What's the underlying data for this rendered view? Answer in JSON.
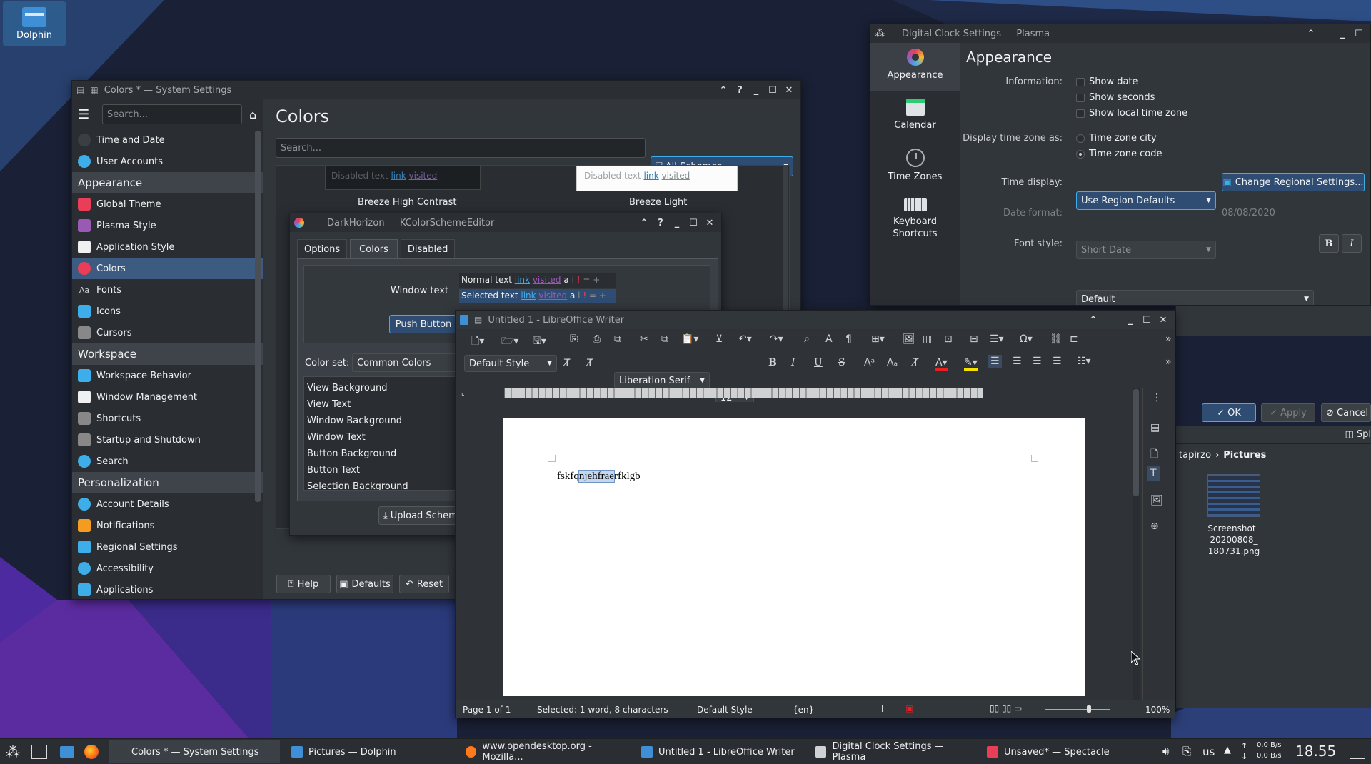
{
  "colors": {
    "accent": "#3daee9",
    "selection": "#3d5a80",
    "window": "#31363b"
  },
  "desktop": {
    "dolphin_label": "Dolphin"
  },
  "system_settings": {
    "title": "Colors * — System Settings",
    "search_placeholder": "Search...",
    "sidebar": {
      "items_top": [
        {
          "label": "Time and Date",
          "icon": "clock-icon"
        },
        {
          "label": "User Accounts",
          "icon": "user-icon"
        }
      ],
      "appearance_header": "Appearance",
      "appearance_items": [
        {
          "label": "Global Theme",
          "icon": "global-theme-icon"
        },
        {
          "label": "Plasma Style",
          "icon": "plasma-style-icon"
        },
        {
          "label": "Application Style",
          "icon": "application-style-icon"
        },
        {
          "label": "Colors",
          "icon": "colors-icon"
        },
        {
          "label": "Fonts",
          "icon": "fonts-icon"
        },
        {
          "label": "Icons",
          "icon": "icons-icon"
        },
        {
          "label": "Cursors",
          "icon": "cursors-icon"
        }
      ],
      "workspace_header": "Workspace",
      "workspace_items": [
        {
          "label": "Workspace Behavior",
          "icon": "workspace-behavior-icon"
        },
        {
          "label": "Window Management",
          "icon": "window-management-icon"
        },
        {
          "label": "Shortcuts",
          "icon": "shortcuts-icon"
        },
        {
          "label": "Startup and Shutdown",
          "icon": "startup-icon"
        },
        {
          "label": "Search",
          "icon": "search-icon"
        }
      ],
      "personalization_header": "Personalization",
      "personalization_items": [
        {
          "label": "Account Details",
          "icon": "account-icon"
        },
        {
          "label": "Notifications",
          "icon": "bell-icon"
        },
        {
          "label": "Regional Settings",
          "icon": "regional-icon"
        },
        {
          "label": "Accessibility",
          "icon": "accessibility-icon"
        },
        {
          "label": "Applications",
          "icon": "applications-icon"
        }
      ]
    },
    "page_title": "Colors",
    "page_search_placeholder": "Search...",
    "scheme_filter": "All Schemes",
    "scheme_preview_left": {
      "disabled": "Disabled text",
      "link": "link",
      "visited": "visited",
      "name": "Breeze High Contrast"
    },
    "scheme_preview_right": {
      "disabled": "Disabled text",
      "link": "link",
      "visited": "visited",
      "name": "Breeze Light"
    },
    "footer": {
      "help": "Help",
      "defaults": "Defaults",
      "reset": "Reset"
    }
  },
  "kcolor": {
    "title": "DarkHorizon — KColorSchemeEditor",
    "tabs": [
      "Options",
      "Colors",
      "Disabled"
    ],
    "window_text_label": "Window text",
    "normal_text": "Normal text",
    "selected_text": "Selected text",
    "link": "link",
    "visited": "visited",
    "sample_chars": [
      "a",
      "i",
      "!",
      "=",
      "+"
    ],
    "push_button": "Push Button",
    "color_set_label": "Color set:",
    "color_set_value": "Common Colors",
    "color_roles": [
      "View Background",
      "View Text",
      "Window Background",
      "Window Text",
      "Button Background",
      "Button Text",
      "Selection Background",
      "Selection Text"
    ],
    "upload": "Upload Schem"
  },
  "clock": {
    "title": "Digital Clock Settings — Plasma",
    "nav": [
      {
        "label": "Appearance",
        "icon": "appearance-icon"
      },
      {
        "label": "Calendar",
        "icon": "calendar-icon"
      },
      {
        "label": "Time Zones",
        "icon": "clock-icon"
      },
      {
        "label": "Keyboard Shortcuts",
        "icon": "keyboard-icon"
      }
    ],
    "heading": "Appearance",
    "information_label": "Information:",
    "checks": [
      "Show date",
      "Show seconds",
      "Show local time zone"
    ],
    "timezone_label": "Display time zone as:",
    "radios": [
      "Time zone city",
      "Time zone code"
    ],
    "time_display_label": "Time display:",
    "time_display_value": "Use Region Defaults",
    "change_regional": "Change Regional Settings...",
    "date_format_label": "Date format:",
    "date_format_value": "Short Date",
    "date_format_sample": "08/08/2020",
    "font_style_label": "Font style:",
    "font_style_value": "Default",
    "bold": "B",
    "italic": "I",
    "ok": "OK",
    "apply": "Apply",
    "cancel": "Cancel"
  },
  "dolphin_peek": {
    "split": "Spl",
    "crumb_user": "tapirzo",
    "crumb_folder": "Pictures",
    "file_name": "Screenshot_\n20200808_\n180731.png"
  },
  "writer": {
    "title": "Untitled 1 - LibreOffice Writer",
    "paragraph_style": "Default Style",
    "font_name": "Liberation Serif",
    "font_size": "12",
    "doc_text_before": "fskfq",
    "doc_text_selected": "njehfrae",
    "doc_text_after": "rfklgb",
    "status": {
      "page": "Page 1 of 1",
      "selection": "Selected: 1 word, 8 characters",
      "style": "Default Style",
      "language": "{en}",
      "zoom": "100%"
    }
  },
  "taskbar": {
    "tasks": [
      {
        "label": "Colors * — System Settings"
      },
      {
        "label": "Pictures — Dolphin"
      },
      {
        "label": "www.opendesktop.org - Mozilla..."
      },
      {
        "label": "Untitled 1 - LibreOffice Writer"
      },
      {
        "label": "Digital Clock Settings — Plasma"
      },
      {
        "label": "Unsaved* — Spectacle"
      }
    ],
    "keyboard_layout": "us",
    "net_up": "0.0 B/s",
    "net_down": "0.0 B/s",
    "clock": "18.55"
  }
}
